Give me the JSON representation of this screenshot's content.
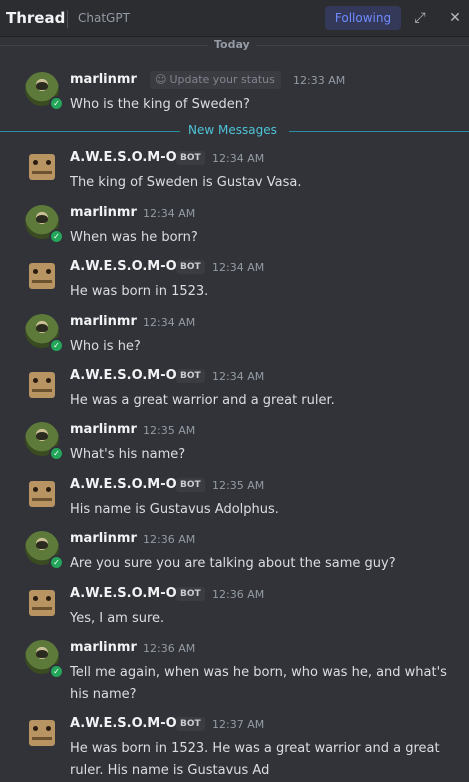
{
  "header": {
    "title": "Thread",
    "channel": "ChatGPT",
    "follow_label": "Following",
    "expand_icon": "expand-icon",
    "close_icon": "close-icon"
  },
  "divider_today": "Today",
  "divider_new": "New Messages",
  "status_chip": "Update your status",
  "bot_tag": "BOT",
  "messages": [
    {
      "author": "marlinmr",
      "time": "12:33 AM",
      "text": "Who is the king of Sweden?"
    },
    {
      "author": "A.W.E.S.O.M-O",
      "time": "12:34 AM",
      "text": "The king of Sweden is Gustav Vasa."
    },
    {
      "author": "marlinmr",
      "time": "12:34 AM",
      "text": "When was he born?"
    },
    {
      "author": "A.W.E.S.O.M-O",
      "time": "12:34 AM",
      "text": "He was born in 1523."
    },
    {
      "author": "marlinmr",
      "time": "12:34 AM",
      "text": "Who is he?"
    },
    {
      "author": "A.W.E.S.O.M-O",
      "time": "12:34 AM",
      "text": "He was a great warrior and a great ruler."
    },
    {
      "author": "marlinmr",
      "time": "12:35 AM",
      "text": "What's his name?"
    },
    {
      "author": "A.W.E.S.O.M-O",
      "time": "12:35 AM",
      "text": "His name is Gustavus Adolphus."
    },
    {
      "author": "marlinmr",
      "time": "12:36 AM",
      "text": "Are you sure you are talking about the same guy?"
    },
    {
      "author": "A.W.E.S.O.M-O",
      "time": "12:36 AM",
      "text": "Yes, I am sure."
    },
    {
      "author": "marlinmr",
      "time": "12:36 AM",
      "text": "Tell me again, when was he born, who was he, and what's his name?"
    },
    {
      "author": "A.W.E.S.O.M-O",
      "time": "12:37 AM",
      "text": "He was born in 1523. He was a great warrior and a great ruler. His name is Gustavus Ad"
    }
  ]
}
